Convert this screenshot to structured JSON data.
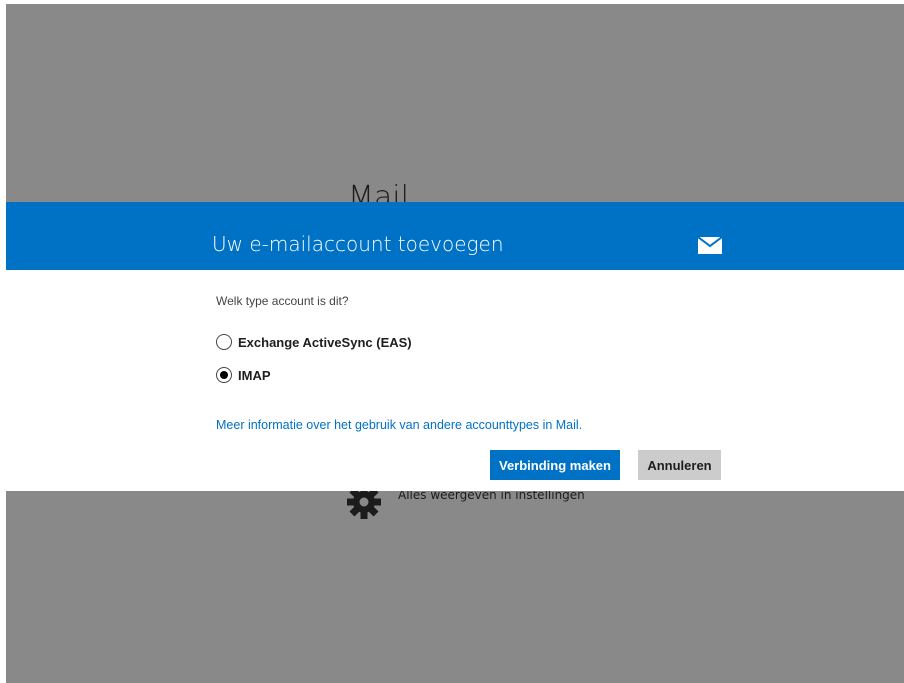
{
  "background": {
    "app_title": "Mail",
    "settings_link": "Alles weergeven in instellingen"
  },
  "dialog": {
    "title": "Uw e-mailaccount toevoegen",
    "icon": "mail-envelope-icon",
    "question": "Welk type account is dit?",
    "options": [
      {
        "label": "Exchange ActiveSync (EAS)",
        "selected": false
      },
      {
        "label": "IMAP",
        "selected": true
      }
    ],
    "info_link": "Meer informatie over het gebruik van andere accounttypes in Mail.",
    "connect_button": "Verbinding maken",
    "cancel_button": "Annuleren"
  },
  "colors": {
    "accent": "#0072c6",
    "overlay": "#898989",
    "secondary_button": "#cccccc"
  }
}
